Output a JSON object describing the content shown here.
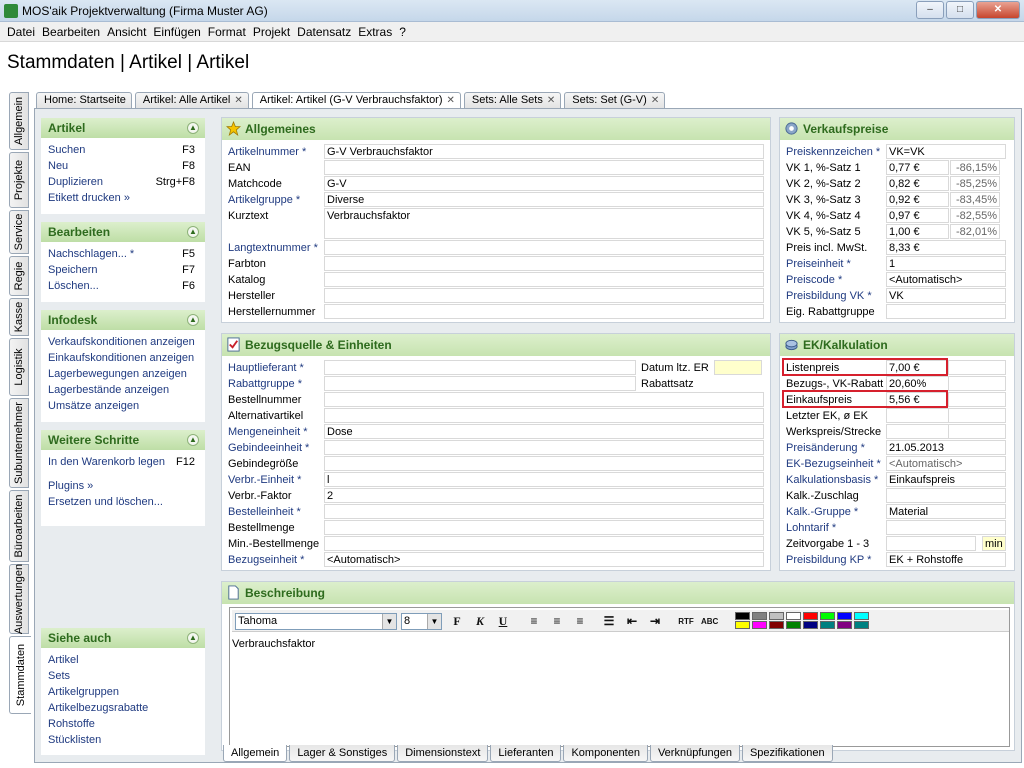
{
  "window": {
    "title": "MOS'aik Projektverwaltung (Firma Muster AG)",
    "minimize": "–",
    "maximize": "□",
    "close": "✕"
  },
  "menu": [
    "Datei",
    "Bearbeiten",
    "Ansicht",
    "Einfügen",
    "Format",
    "Projekt",
    "Datensatz",
    "Extras",
    "?"
  ],
  "page_title": "Stammdaten | Artikel | Artikel",
  "vertical_tabs": [
    "Allgemein",
    "Projekte",
    "Service",
    "Regie",
    "Kasse",
    "Logistik",
    "Subunternehmer",
    "Büroarbeiten",
    "Auswertungen",
    "Stammdaten"
  ],
  "doc_tabs": [
    "Home: Startseite",
    "Artikel: Alle Artikel",
    "Artikel: Artikel (G-V Verbrauchsfaktor)",
    "Sets: Alle Sets",
    "Sets: Set (G-V)"
  ],
  "sidebar": {
    "artikel": {
      "title": "Artikel",
      "items": [
        {
          "label": "Suchen",
          "shortcut": "F3"
        },
        {
          "label": "Neu",
          "shortcut": "F8"
        },
        {
          "label": "Duplizieren",
          "shortcut": "Strg+F8"
        },
        {
          "label": "Etikett drucken »",
          "shortcut": ""
        }
      ]
    },
    "bearbeiten": {
      "title": "Bearbeiten",
      "items": [
        {
          "label": "Nachschlagen... *",
          "shortcut": "F5"
        },
        {
          "label": "Speichern",
          "shortcut": "F7"
        },
        {
          "label": "Löschen...",
          "shortcut": "F6"
        }
      ]
    },
    "infodesk": {
      "title": "Infodesk",
      "items": [
        {
          "label": "Verkaufskonditionen anzeigen"
        },
        {
          "label": "Einkaufskonditionen anzeigen"
        },
        {
          "label": "Lagerbewegungen anzeigen"
        },
        {
          "label": "Lagerbestände anzeigen"
        },
        {
          "label": "Umsätze anzeigen"
        }
      ]
    },
    "weitere": {
      "title": "Weitere Schritte",
      "items": [
        {
          "label": "In den Warenkorb legen",
          "shortcut": "F12"
        },
        {
          "label": "Plugins »",
          "shortcut": ""
        },
        {
          "label": "Ersetzen und löschen...",
          "shortcut": ""
        }
      ]
    },
    "siehe": {
      "title": "Siehe auch",
      "items": [
        "Artikel",
        "Sets",
        "Artikelgruppen",
        "Artikelbezugsrabatte",
        "Rohstoffe",
        "Stücklisten"
      ]
    }
  },
  "allgemeines": {
    "title": "Allgemeines",
    "rows": [
      {
        "label": "Artikelnummer *",
        "value": "G-V Verbrauchsfaktor",
        "link": true
      },
      {
        "label": "EAN",
        "value": "",
        "link": false
      },
      {
        "label": "Matchcode",
        "value": "G-V",
        "link": false
      },
      {
        "label": "Artikelgruppe *",
        "value": "Diverse",
        "link": true
      },
      {
        "label": "Kurztext",
        "value": "Verbrauchsfaktor",
        "link": false
      },
      {
        "label": "Langtextnummer *",
        "value": "",
        "link": true
      },
      {
        "label": "Farbton",
        "value": "",
        "link": false
      },
      {
        "label": "Katalog",
        "value": "",
        "link": false
      },
      {
        "label": "Hersteller",
        "value": "",
        "link": false
      },
      {
        "label": "Herstellernummer",
        "value": "",
        "link": false
      }
    ]
  },
  "bezugsquelle": {
    "title": "Bezugsquelle & Einheiten",
    "datum_label": "Datum ltz. ER",
    "rabattsatz_label": "Rabattsatz",
    "rows": [
      {
        "label": "Hauptlieferant *",
        "value": "",
        "link": true
      },
      {
        "label": "Rabattgruppe *",
        "value": "",
        "link": true
      },
      {
        "label": "Bestellnummer",
        "value": "",
        "link": false
      },
      {
        "label": "Alternativartikel",
        "value": "",
        "link": false
      },
      {
        "label": "Mengeneinheit *",
        "value": "Dose",
        "link": true
      },
      {
        "label": "Gebindeeinheit *",
        "value": "",
        "link": true
      },
      {
        "label": "Gebindegröße",
        "value": "",
        "link": false
      },
      {
        "label": "Verbr.-Einheit *",
        "value": "l",
        "link": true
      },
      {
        "label": "Verbr.-Faktor",
        "value": "2",
        "link": false
      },
      {
        "label": "Bestelleinheit *",
        "value": "",
        "link": true
      },
      {
        "label": "Bestellmenge",
        "value": "",
        "link": false
      },
      {
        "label": "Min.-Bestellmenge",
        "value": "",
        "link": false
      },
      {
        "label": "Bezugseinheit *",
        "value": "<Automatisch>",
        "link": true
      }
    ]
  },
  "verkaufspreise": {
    "title": "Verkaufspreise",
    "rows": [
      {
        "label": "Preiskennzeichen *",
        "value": "VK=VK",
        "pct": null,
        "link": true
      },
      {
        "label": "VK 1, %-Satz 1",
        "value": "0,77 €",
        "pct": "-86,15%",
        "link": false
      },
      {
        "label": "VK 2, %-Satz 2",
        "value": "0,82 €",
        "pct": "-85,25%",
        "link": false
      },
      {
        "label": "VK 3, %-Satz 3",
        "value": "0,92 €",
        "pct": "-83,45%",
        "link": false
      },
      {
        "label": "VK 4, %-Satz 4",
        "value": "0,97 €",
        "pct": "-82,55%",
        "link": false
      },
      {
        "label": "VK 5, %-Satz 5",
        "value": "1,00 €",
        "pct": "-82,01%",
        "link": false
      },
      {
        "label": "Preis incl. MwSt.",
        "value": "8,33 €",
        "pct": null,
        "link": false
      },
      {
        "label": "Preiseinheit *",
        "value": "1",
        "pct": null,
        "link": true
      },
      {
        "label": "Preiscode *",
        "value": "<Automatisch>",
        "pct": null,
        "link": true
      },
      {
        "label": "Preisbildung VK *",
        "value": "VK",
        "pct": null,
        "link": true
      },
      {
        "label": "Eig. Rabattgruppe",
        "value": "",
        "pct": null,
        "link": false
      }
    ]
  },
  "ek": {
    "title": "EK/Kalkulation",
    "rows": [
      {
        "label": "Listenpreis",
        "value": "7,00 €",
        "link": false,
        "hl": true
      },
      {
        "label": "Bezugs-, VK-Rabatt",
        "value": "20,60%",
        "link": false
      },
      {
        "label": "Einkaufspreis",
        "value": "5,56 €",
        "link": false,
        "hl": true
      },
      {
        "label": "Letzter EK, ø EK",
        "value": "",
        "link": false
      },
      {
        "label": "Werkspreis/Strecke",
        "value": "",
        "link": false
      },
      {
        "label": "Preisänderung *",
        "value": "21.05.2013",
        "link": true
      },
      {
        "label": "EK-Bezugseinheit *",
        "value": "<Automatisch>",
        "link": true,
        "gray": true
      },
      {
        "label": "Kalkulationsbasis *",
        "value": "Einkaufspreis",
        "link": true
      },
      {
        "label": "Kalk.-Zuschlag",
        "value": "",
        "link": false
      },
      {
        "label": "Kalk.-Gruppe *",
        "value": "Material",
        "link": true
      },
      {
        "label": "Lohntarif *",
        "value": "",
        "link": true
      },
      {
        "label": "Zeitvorgabe 1 - 3",
        "value": "",
        "link": false,
        "unit": "min"
      },
      {
        "label": "Preisbildung KP *",
        "value": "EK + Rohstoffe",
        "link": true
      }
    ]
  },
  "beschreibung": {
    "title": "Beschreibung",
    "font": "Tahoma",
    "size": "8",
    "text": "Verbrauchsfaktor",
    "swatches": [
      "#000000",
      "#808080",
      "#c0c0c0",
      "#ffffff",
      "#ff0000",
      "#00ff00",
      "#0000ff",
      "#00ffff",
      "#ffff00",
      "#ff00ff",
      "#800000",
      "#008000",
      "#000080",
      "#008080",
      "#800080",
      "#008080"
    ]
  },
  "bottom_tabs": [
    "Allgemein",
    "Lager & Sonstiges",
    "Dimensionstext",
    "Lieferanten",
    "Komponenten",
    "Verknüpfungen",
    "Spezifikationen"
  ]
}
